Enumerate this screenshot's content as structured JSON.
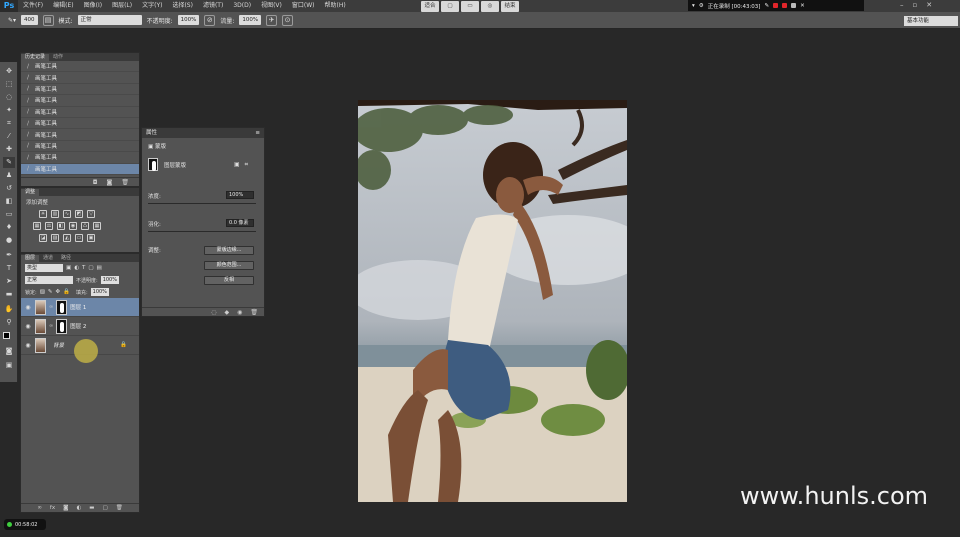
{
  "app": {
    "logo": "Ps"
  },
  "menubar": {
    "items": [
      "文件(F)",
      "编辑(E)",
      "图像(I)",
      "图层(L)",
      "文字(Y)",
      "选择(S)",
      "滤镜(T)",
      "3D(D)",
      "视图(V)",
      "窗口(W)",
      "帮助(H)"
    ]
  },
  "center_buttons": [
    "适合",
    "",
    "",
    "",
    "结束"
  ],
  "recorder": {
    "status": "正在录制 [00:43:03]"
  },
  "options": {
    "brush_size": "400",
    "mode_label": "模式:",
    "mode_value": "正常",
    "opacity_label": "不透明度:",
    "opacity_value": "100%",
    "flow_label": "流量:",
    "flow_value": "100%",
    "workspace": "基本功能"
  },
  "history": {
    "tabs": [
      "历史记录",
      "动作"
    ],
    "items": [
      "画笔工具",
      "画笔工具",
      "画笔工具",
      "画笔工具",
      "画笔工具",
      "画笔工具",
      "画笔工具",
      "画笔工具",
      "画笔工具",
      "画笔工具"
    ],
    "selected_index": 9
  },
  "adjustments": {
    "tab": "调整",
    "title": "添加调整"
  },
  "layers": {
    "tabs": [
      "图层",
      "通道",
      "路径"
    ],
    "kind": "类型",
    "blend": "正常",
    "opacity_label": "不透明度:",
    "opacity_value": "100%",
    "lock_label": "锁定:",
    "fill_label": "填充:",
    "fill_value": "100%",
    "items": [
      {
        "name": "图层 1",
        "selected": true
      },
      {
        "name": "图层 2",
        "selected": false
      },
      {
        "name": "背景",
        "selected": false
      }
    ]
  },
  "properties": {
    "tab": "属性",
    "mask_label": "蒙版",
    "layer_mask": "图层蒙版",
    "density_label": "浓度:",
    "density_value": "100%",
    "feather_label": "羽化:",
    "feather_value": "0.0 像素",
    "refine_label": "调整:",
    "edge_button": "蒙版边缘...",
    "color_button": "颜色范围...",
    "invert_button": "反相"
  },
  "watermark": "www.hunls.com",
  "timer": "00:58:02",
  "colors": {
    "selection": "#6c86a8",
    "accent": "#31a8ff",
    "record": "#e0252a"
  }
}
